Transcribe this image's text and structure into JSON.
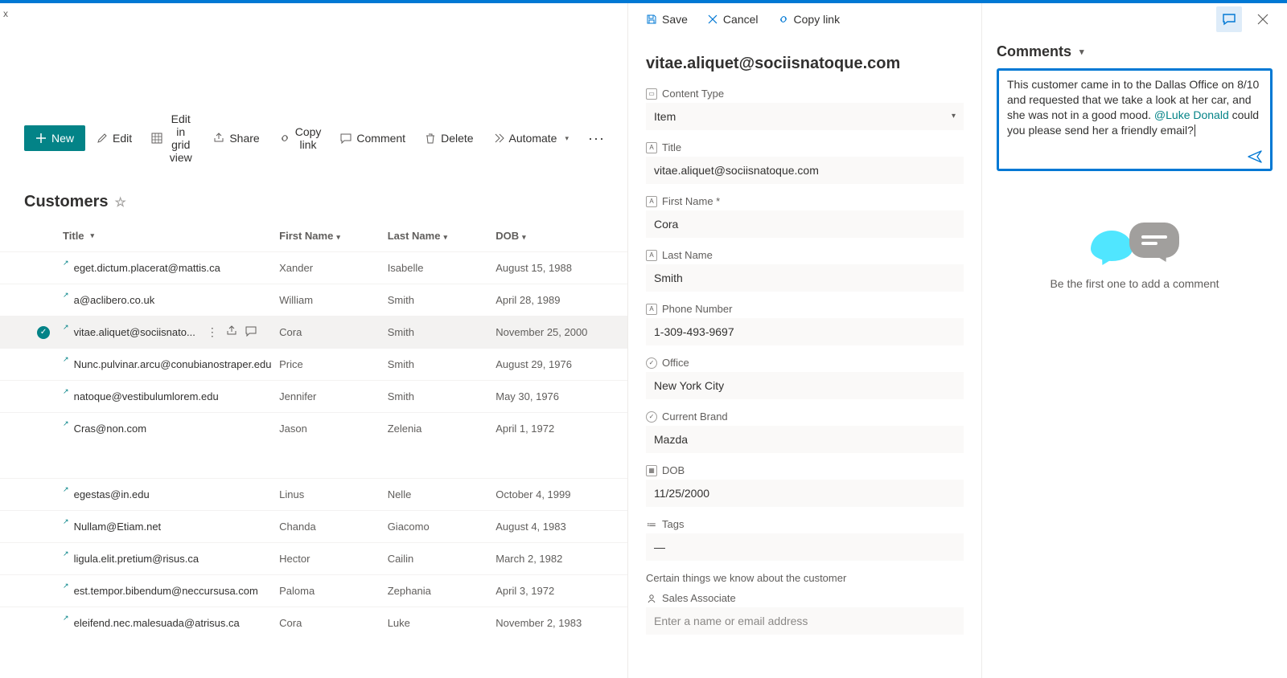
{
  "top_letter": "x",
  "toolbar": {
    "new_label": "New",
    "edit_label": "Edit",
    "grid_label": "Edit in grid view",
    "share_label": "Share",
    "copy_label": "Copy link",
    "comment_label": "Comment",
    "delete_label": "Delete",
    "automate_label": "Automate"
  },
  "list": {
    "title": "Customers",
    "columns": {
      "title": "Title",
      "first_name": "First Name",
      "last_name": "Last Name",
      "dob": "DOB"
    },
    "rows": [
      {
        "title": "eget.dictum.placerat@mattis.ca",
        "fn": "Xander",
        "ln": "Isabelle",
        "dob": "August 15, 1988",
        "selected": false
      },
      {
        "title": "a@aclibero.co.uk",
        "fn": "William",
        "ln": "Smith",
        "dob": "April 28, 1989",
        "selected": false
      },
      {
        "title": "vitae.aliquet@sociisnato...",
        "fn": "Cora",
        "ln": "Smith",
        "dob": "November 25, 2000",
        "selected": true
      },
      {
        "title": "Nunc.pulvinar.arcu@conubianostraper.edu",
        "fn": "Price",
        "ln": "Smith",
        "dob": "August 29, 1976",
        "selected": false
      },
      {
        "title": "natoque@vestibulumlorem.edu",
        "fn": "Jennifer",
        "ln": "Smith",
        "dob": "May 30, 1976",
        "selected": false
      },
      {
        "title": "Cras@non.com",
        "fn": "Jason",
        "ln": "Zelenia",
        "dob": "April 1, 1972",
        "selected": false
      },
      {
        "gap": true
      },
      {
        "title": "egestas@in.edu",
        "fn": "Linus",
        "ln": "Nelle",
        "dob": "October 4, 1999",
        "selected": false
      },
      {
        "title": "Nullam@Etiam.net",
        "fn": "Chanda",
        "ln": "Giacomo",
        "dob": "August 4, 1983",
        "selected": false
      },
      {
        "title": "ligula.elit.pretium@risus.ca",
        "fn": "Hector",
        "ln": "Cailin",
        "dob": "March 2, 1982",
        "selected": false
      },
      {
        "title": "est.tempor.bibendum@neccursusa.com",
        "fn": "Paloma",
        "ln": "Zephania",
        "dob": "April 3, 1972",
        "selected": false
      },
      {
        "title": "eleifend.nec.malesuada@atrisus.ca",
        "fn": "Cora",
        "ln": "Luke",
        "dob": "November 2, 1983",
        "selected": false
      }
    ]
  },
  "panel": {
    "save_label": "Save",
    "cancel_label": "Cancel",
    "copy_label": "Copy link",
    "title": "vitae.aliquet@sociisnatoque.com",
    "fields": {
      "content_type_label": "Content Type",
      "content_type_value": "Item",
      "title_label": "Title",
      "title_value": "vitae.aliquet@sociisnatoque.com",
      "first_name_label": "First Name *",
      "first_name_value": "Cora",
      "last_name_label": "Last Name",
      "last_name_value": "Smith",
      "phone_label": "Phone Number",
      "phone_value": "1-309-493-9697",
      "office_label": "Office",
      "office_value": "New York City",
      "brand_label": "Current Brand",
      "brand_value": "Mazda",
      "dob_label": "DOB",
      "dob_value": "11/25/2000",
      "tags_label": "Tags",
      "tags_value": "—",
      "section_note": "Certain things we know about the customer",
      "sa_label": "Sales Associate",
      "sa_placeholder": "Enter a name or email address"
    }
  },
  "comments": {
    "header": "Comments",
    "draft_pre": "This customer came in to the Dallas Office on 8/10 and requested that we take a look at her car, and she was not in a good mood. ",
    "draft_mention": "@Luke Donald",
    "draft_post": " could you please send her a friendly email?",
    "empty_text": "Be the first one to add a comment"
  }
}
